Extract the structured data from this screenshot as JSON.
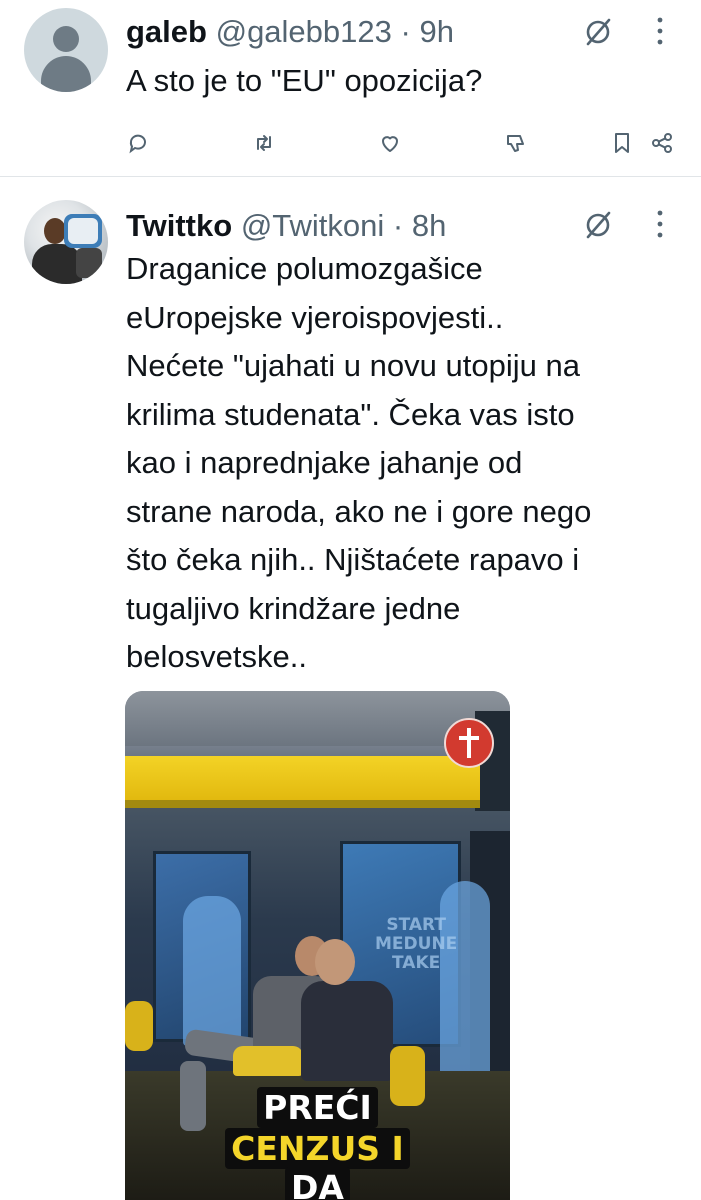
{
  "tweets": [
    {
      "name": "galeb",
      "handle": "@galebb123",
      "time": "· 9h",
      "text_lines": [
        "A sto je to \"EU\" opozicija?"
      ],
      "actions": [
        "reply-icon",
        "retweet-icon",
        "like-icon",
        "grok-icon",
        "bookmark-icon",
        "share-icon"
      ]
    },
    {
      "name": "Twittko",
      "handle": "@Twitkoni",
      "time": "· 8h",
      "text_lines": [
        "Draganice polumozgašice",
        "eUropejske vjeroispovjesti..",
        "Nećete \"ujahati u novu utopiju na",
        "krilima studenata\". Čeka vas isto",
        "kao i naprednjake jahanje od",
        "strane naroda, ako ne i gore nego",
        "što čeka njih.. Njištaćete rapavo i",
        "tugaljivo krindžare jedne",
        "belosvetske.."
      ],
      "media": {
        "studio_text": [
          "START",
          "MEDUNE",
          "TAKE"
        ],
        "caption_lines": [
          "PREĆI",
          "CENZUS I",
          "DA"
        ]
      }
    }
  ],
  "colors": {
    "text": "#0f1419",
    "secondary": "#536471",
    "divider": "#e1e5e8",
    "caption_yellow": "#f4d52a"
  }
}
